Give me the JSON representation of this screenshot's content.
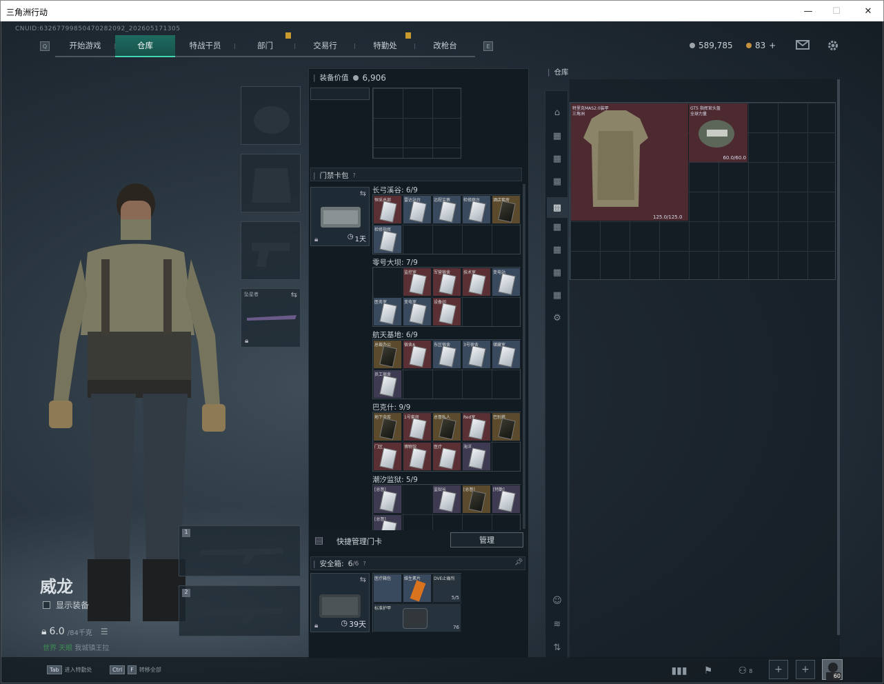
{
  "window": {
    "title": "三角洲行动",
    "minimize": "—",
    "maximize": "☐",
    "close": "✕"
  },
  "uid": "CNUID:6326779985047028​2092_202605171305",
  "nav": {
    "tabs": [
      {
        "label": "开始游戏"
      },
      {
        "label": "仓库",
        "active": true
      },
      {
        "label": "特战干员"
      },
      {
        "label": "部门",
        "badge": true
      },
      {
        "label": "交易行"
      },
      {
        "label": "特勤处",
        "badge": true
      },
      {
        "label": "改枪台"
      }
    ]
  },
  "currency": {
    "silver": "589,785",
    "gold": "83",
    "plus": "+"
  },
  "character": {
    "name": "威龙",
    "show_equipment": "显示装备",
    "weight": "6.0",
    "weight_max": "/84千克",
    "status_prefix": "世界 天眼",
    "status_text": "我城镇王拉"
  },
  "loadout": {
    "slot4_label": "坠星者",
    "weapon1_num": "1",
    "weapon2_num": "2"
  },
  "equipment_value": {
    "label": "装备价值",
    "value": "6,906"
  },
  "keycard": {
    "header": "门禁卡包",
    "help": "?",
    "duration": "1天",
    "maps": [
      {
        "name": "长弓溪谷: 6/9",
        "cards": [
          [
            "恒采总部",
            "r"
          ],
          [
            "雷达站台",
            "b"
          ],
          [
            "远程监察",
            "b"
          ],
          [
            "检修廊台",
            "b"
          ],
          [
            "酒店套房",
            "y"
          ],
          [
            "检修指挥",
            "b"
          ]
        ]
      },
      {
        "name": "零号大坝: 7/9",
        "cards": [
          [
            "",
            "x"
          ],
          [
            "监控室",
            "r"
          ],
          [
            "军营宿舍",
            "r"
          ],
          [
            "技术室",
            "r"
          ],
          [
            "变电站",
            "b"
          ],
          [
            "医务室",
            "b"
          ],
          [
            "变电室",
            "b"
          ],
          [
            "设备间",
            "r"
          ]
        ]
      },
      {
        "name": "航天基地: 6/9",
        "cards": [
          [
            "总裁办公",
            "y"
          ],
          [
            "宿舍A",
            "r"
          ],
          [
            "东区宿舍",
            "b"
          ],
          [
            "3号宿舍",
            "b"
          ],
          [
            "储藏室",
            "b"
          ],
          [
            "员工宿舍",
            "p"
          ]
        ]
      },
      {
        "name": "巴克什: 9/9",
        "cards": [
          [
            "地下金库",
            "y"
          ],
          [
            "1号套房",
            "r"
          ],
          [
            "总督私人",
            "y"
          ],
          [
            "Red室",
            "r"
          ],
          [
            "巴别塔",
            "y"
          ],
          [
            "门区",
            "r"
          ],
          [
            "博物馆",
            "r"
          ],
          [
            "医疗",
            "r"
          ],
          [
            "海洋",
            "p"
          ]
        ]
      },
      {
        "name": "潮汐监狱: 5/9",
        "cards": [
          [
            "[总督]",
            "p"
          ],
          [
            "",
            "x"
          ],
          [
            "监狱长",
            "p"
          ],
          [
            "[总督]",
            "y"
          ],
          [
            "[特勤]",
            "p"
          ],
          [
            "[总督]",
            "p"
          ]
        ]
      }
    ],
    "quick_manage": "快捷管理门卡",
    "manage_btn": "管理"
  },
  "safebox": {
    "header": "安全箱:",
    "count": "6",
    "capacity": "/6",
    "help": "?",
    "duration": "39天",
    "items": [
      "医疗箱包",
      "维生素片",
      "DVE止痛剂",
      "标准护甲"
    ],
    "item3_count": "5/5",
    "item4_count": "76"
  },
  "stash": {
    "label": "仓库",
    "armor": {
      "name": "特里克MAS2.0装甲",
      "sub": "三角洲",
      "durability": "125.0/125.0"
    },
    "helmet": {
      "name": "GT5 指挥官头盔",
      "sub": "全球力量",
      "durability": "60.0/60.0"
    }
  },
  "bottom": {
    "tab_key": "Tab",
    "tab_label": "进入特勤处",
    "ctrl_key": "Ctrl",
    "f_key": "F",
    "ctrl_label": "转移全部",
    "friends_count": "8",
    "level": "60"
  }
}
